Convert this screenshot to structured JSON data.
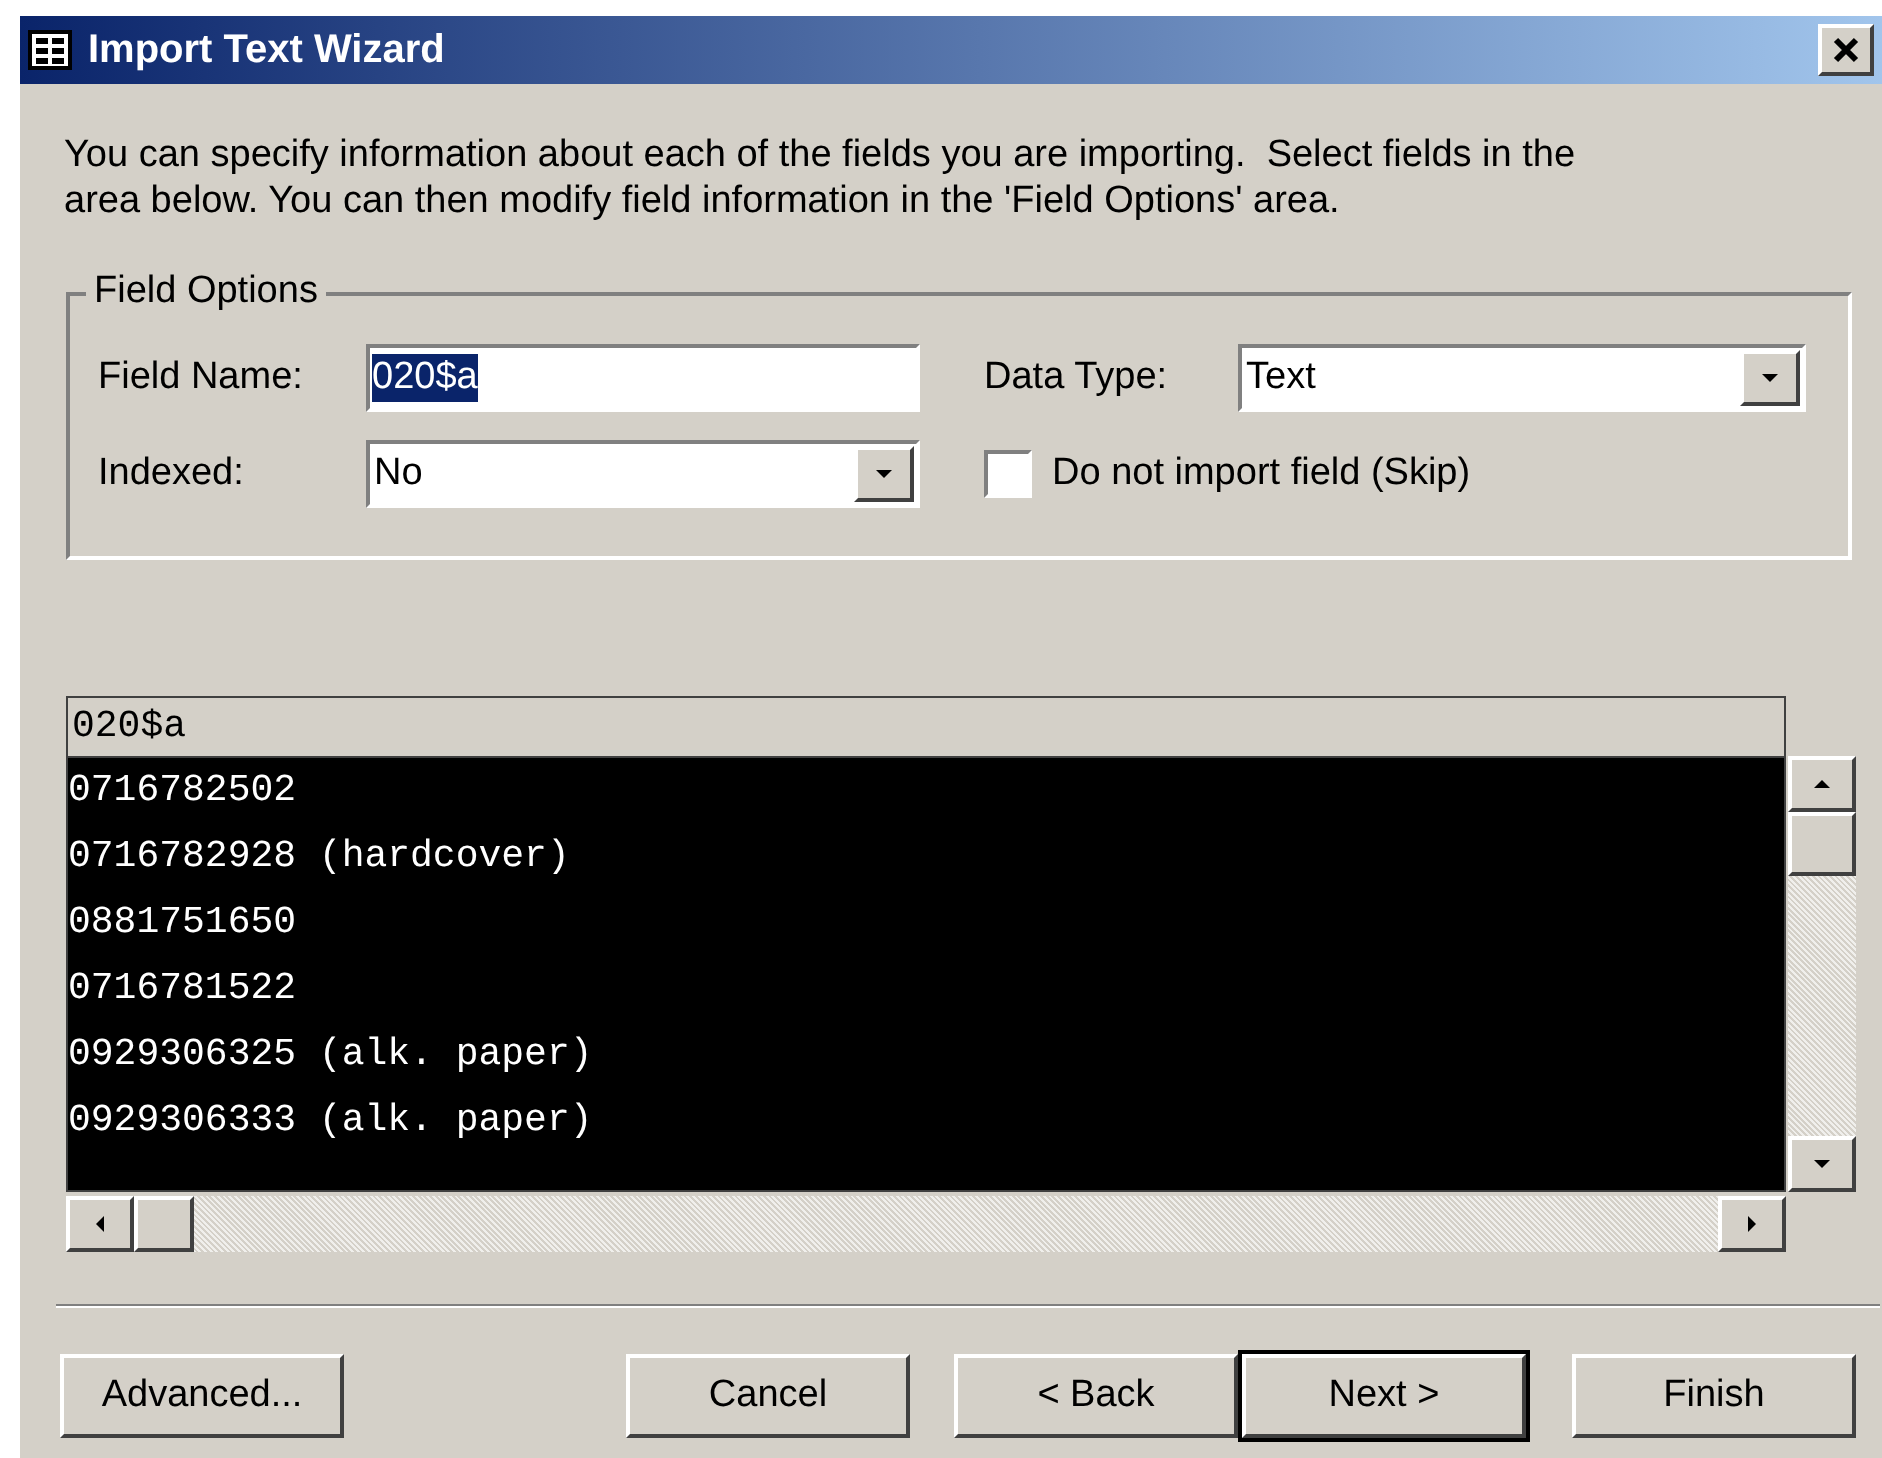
{
  "window": {
    "title": "Import Text Wizard"
  },
  "description": [
    "You can specify information about each of the fields you are importing.  Select fields in the",
    "area below. You can then modify field information in the 'Field Options' area."
  ],
  "field_options": {
    "title": "Field Options",
    "field_name": {
      "label": "Field Name:",
      "value": "020$a"
    },
    "data_type": {
      "label": "Data Type:",
      "value": "Text"
    },
    "indexed": {
      "label": "Indexed:",
      "value": "No"
    },
    "skip": {
      "label": "Do not import field (Skip)",
      "checked": false
    }
  },
  "preview": {
    "column_header": "020$a",
    "selected": true,
    "rows": [
      "0716782502",
      "0716782928 (hardcover)",
      "0881751650",
      "0716781522",
      "0929306325 (alk. paper)",
      "0929306333 (alk. paper)"
    ]
  },
  "buttons": [
    {
      "label": "Advanced...",
      "default": false
    },
    {
      "label": "Cancel",
      "default": false
    },
    {
      "label": "< Back",
      "default": false
    },
    {
      "label": "Next >",
      "default": true
    },
    {
      "label": "Finish",
      "default": false
    }
  ]
}
